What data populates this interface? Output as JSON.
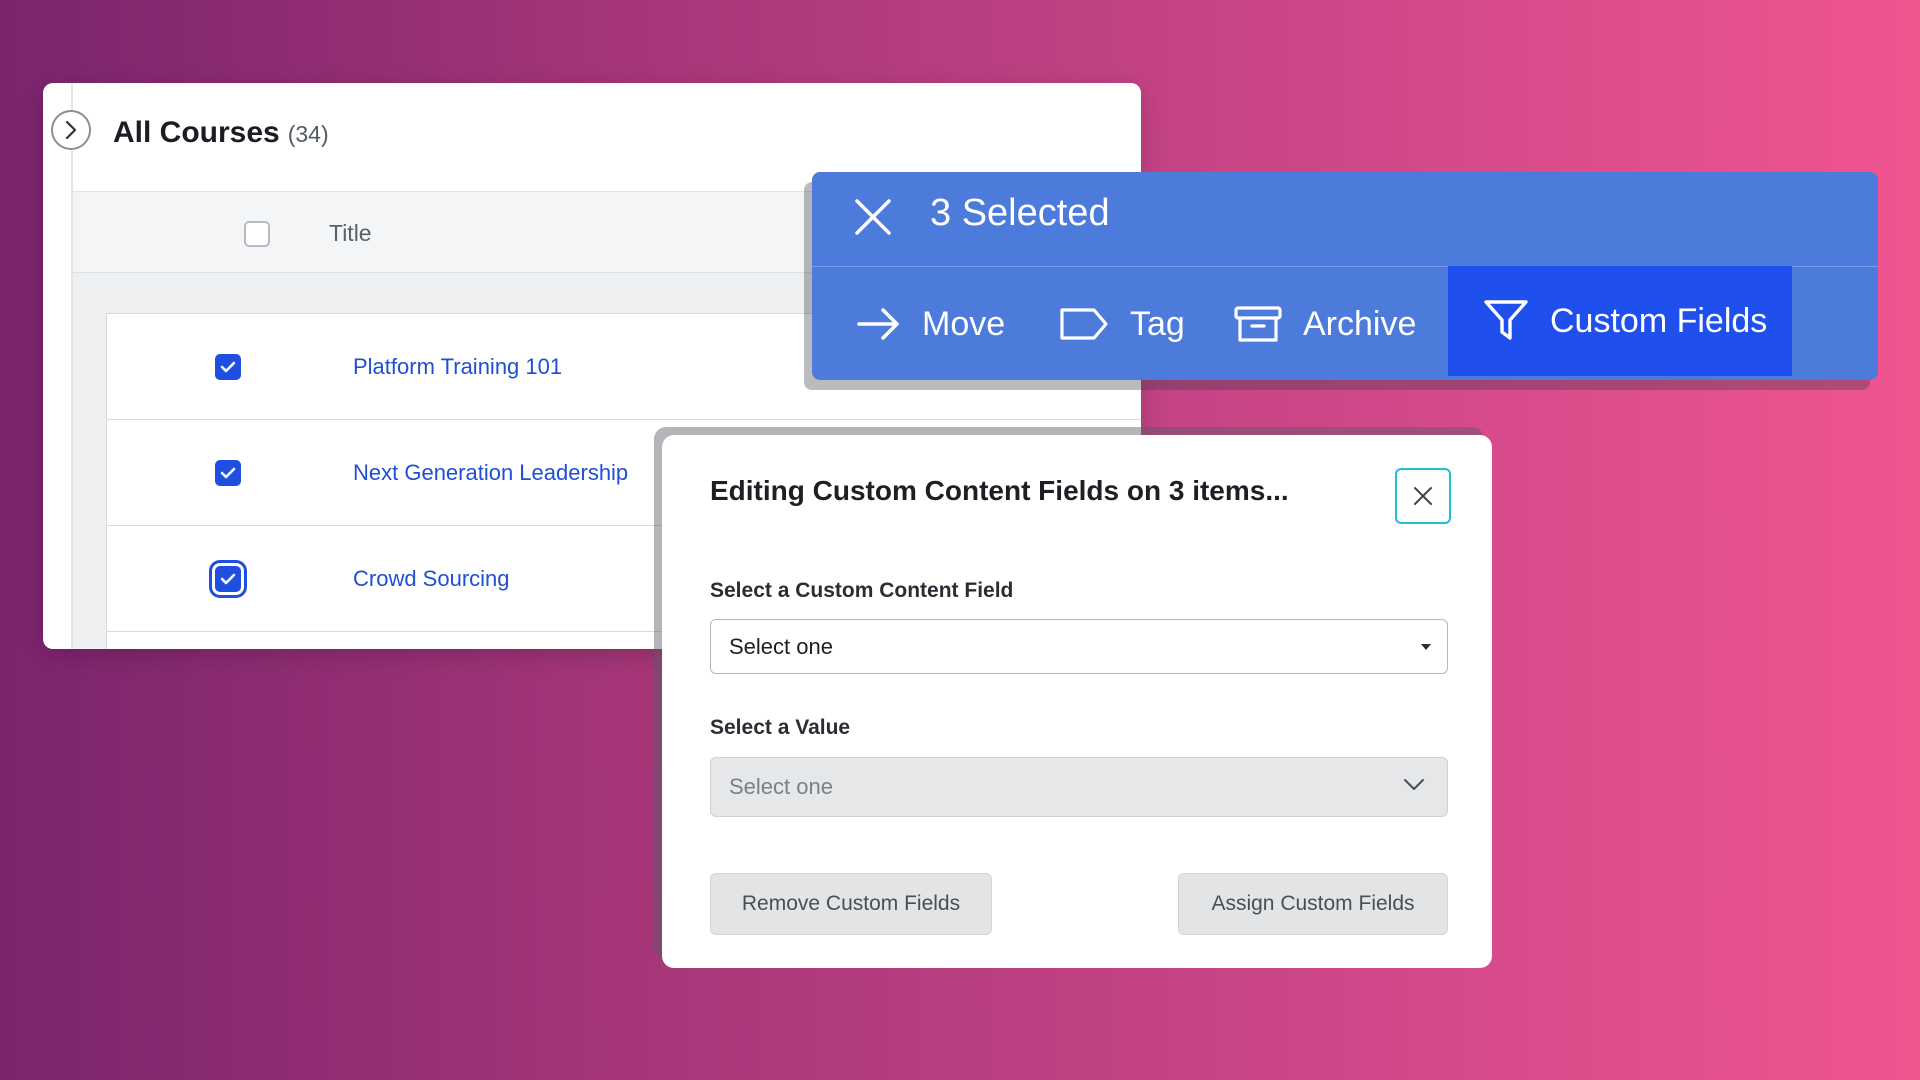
{
  "courses": {
    "title": "All Courses",
    "count": "(34)",
    "column_title": "Title",
    "rows": [
      {
        "title": "Platform Training 101"
      },
      {
        "title": "Next Generation Leadership"
      },
      {
        "title": "Crowd Sourcing"
      }
    ]
  },
  "bulk_bar": {
    "selected": "3 Selected",
    "actions": {
      "move": "Move",
      "tag": "Tag",
      "archive": "Archive",
      "custom_fields": "Custom Fields"
    }
  },
  "modal": {
    "title": "Editing Custom Content Fields on 3 items...",
    "field_label": "Select a Custom Content Field",
    "field_value": "Select one",
    "value_label": "Select a Value",
    "value_placeholder": "Select one",
    "remove_button": "Remove Custom Fields",
    "assign_button": "Assign Custom Fields"
  },
  "colors": {
    "action_bar": "#4d7bdb",
    "action_active": "#1f50ee",
    "link": "#1f4fd6",
    "checkbox": "#1f4fe0",
    "focus_ring": "#1fc0d0"
  }
}
